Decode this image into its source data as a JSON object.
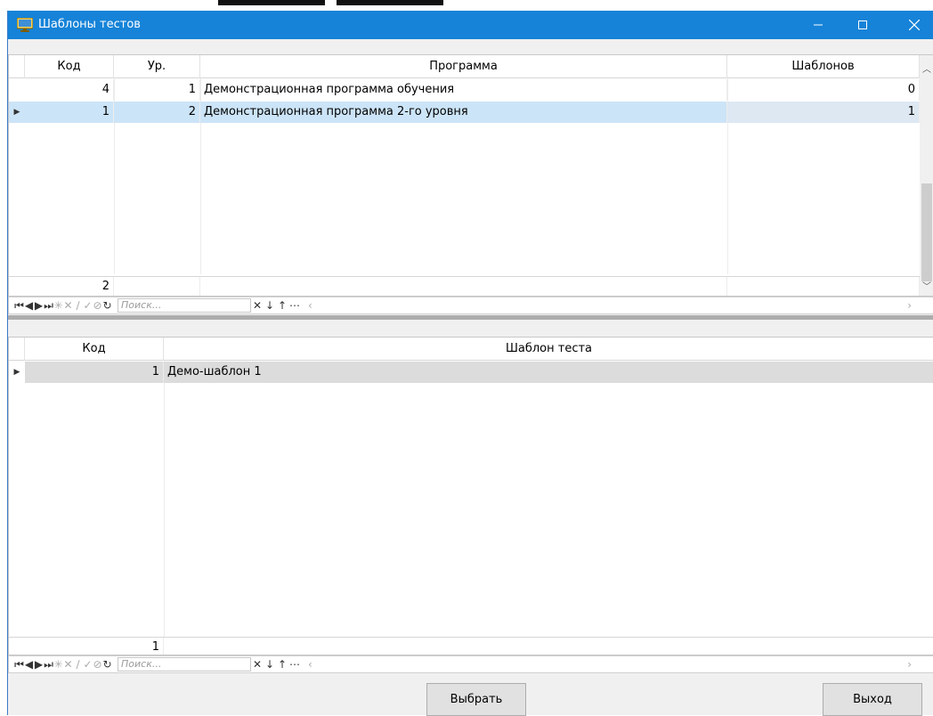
{
  "window": {
    "title": "Шаблоны тестов",
    "icons": {
      "app": "app-monitor-icon",
      "min": "minimize-icon",
      "max": "maximize-icon",
      "close": "close-icon"
    },
    "accent_color": "#1683d8"
  },
  "programs_grid": {
    "headers": {
      "code": "Код",
      "level": "Ур.",
      "program": "Программа",
      "templates": "Шаблонов"
    },
    "rows": [
      {
        "code": "4",
        "level": "1",
        "program": "Демонстрационная программа обучения",
        "templates": "0"
      },
      {
        "code": "1",
        "level": "2",
        "program": "Демонстрационная программа 2-го уровня",
        "templates": "1"
      }
    ],
    "footer_count": "2",
    "selected_row_color": "#cce4f7"
  },
  "templates_grid": {
    "headers": {
      "code": "Код",
      "template": "Шаблон теста"
    },
    "rows": [
      {
        "code": "1",
        "template": "Демо-шаблон 1"
      }
    ],
    "footer_count": "1"
  },
  "navigator": {
    "search_placeholder": "Поиск...",
    "icons": [
      "first-record-icon",
      "prev-record-icon",
      "next-record-icon",
      "last-record-icon",
      "insert-icon",
      "delete-icon",
      "edit-icon",
      "post-icon",
      "cancel-icon",
      "refresh-icon",
      "clear-search-icon",
      "search-next-icon",
      "search-prev-icon",
      "more-icon"
    ]
  },
  "buttons": {
    "select": "Выбрать",
    "exit": "Выход"
  }
}
